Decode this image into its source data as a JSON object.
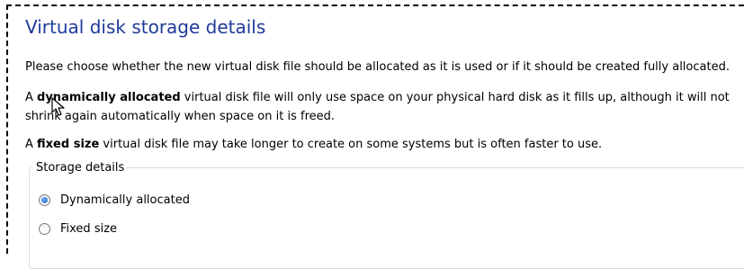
{
  "page": {
    "title": "Virtual disk storage details",
    "intro": "Please choose whether the new virtual disk file should be allocated as it is used or if it should be created fully allocated.",
    "dynamic_desc": {
      "prefix": "A ",
      "bold": "dynamically allocated",
      "line1_rest": " virtual disk file will only use space on your physical hard disk as it fills up, although it will not",
      "line2": "shrink again automatically when space on it is freed."
    },
    "fixed_desc": {
      "prefix": "A ",
      "bold": "fixed size",
      "rest": " virtual disk file may take longer to create on some systems but is often faster to use."
    }
  },
  "storage": {
    "legend": "Storage details",
    "options": [
      {
        "label": "Dynamically allocated",
        "selected": true
      },
      {
        "label": "Fixed size",
        "selected": false
      }
    ]
  },
  "colors": {
    "title": "#1f3b99",
    "group_border": "#d5dfe5"
  },
  "icons": {
    "cursor": "mouse-pointer-icon"
  }
}
